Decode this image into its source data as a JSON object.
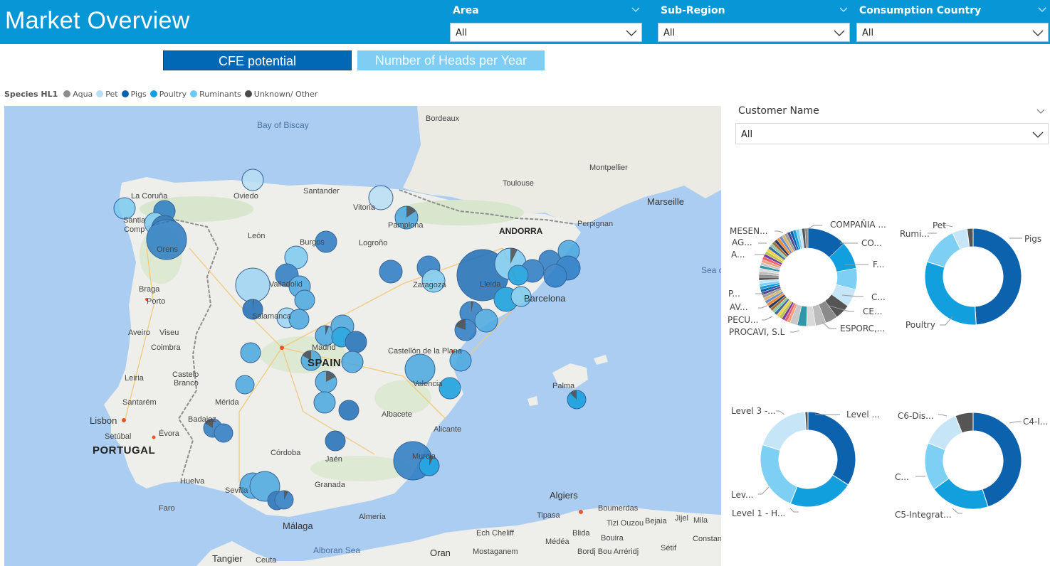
{
  "header": {
    "title": "Market Overview",
    "slicers": [
      {
        "label": "Area",
        "value": "All"
      },
      {
        "label": "Sub-Region",
        "value": "All"
      },
      {
        "label": "Consumption Country",
        "value": "All"
      }
    ]
  },
  "toggles": {
    "active": "CFE potential",
    "inactive": "Number of Heads per Year"
  },
  "legend": {
    "title": "Species HL1",
    "items": [
      {
        "label": "Aqua",
        "color": "#8c8c8c"
      },
      {
        "label": "Pet",
        "color": "#b8def5"
      },
      {
        "label": "Pigs",
        "color": "#0d62ad"
      },
      {
        "label": "Poultry",
        "color": "#129fde"
      },
      {
        "label": "Ruminants",
        "color": "#6dc9f0"
      },
      {
        "label": "Unknown/ Other",
        "color": "#4a4a4a"
      }
    ]
  },
  "map": {
    "labels": {
      "bay": "Bay of Biscay",
      "bordeaux": "Bordeaux",
      "montpellier": "Montpellier",
      "toulouse": "Toulouse",
      "marseille": "Marseille",
      "perpignan": "Perpignan",
      "andorra": "ANDORRA",
      "sea": "Sea o",
      "lacoruna": "La Coruña",
      "santiago": "Santia",
      "compostela": "Comp",
      "ourense": "Orens",
      "oviedo": "Oviedo",
      "santander": "Santander",
      "vitoria": "Vitoria",
      "pamplona": "Pamplona",
      "leon": "León",
      "burgos": "Burgos",
      "logrono": "Logroño",
      "braga": "Braga",
      "porto": "Porto",
      "valladolid": "Valladolid",
      "zaragoza": "Zaragoza",
      "lleida": "Lleida",
      "barcelona": "Barcelona",
      "salamanca": "Salamanca",
      "aveiro": "Aveiro",
      "viseu": "Viseu",
      "coimbra": "Coimbra",
      "madrid": "Madrid",
      "spain": "SPAIN",
      "castellon": "Castellón de la Plana",
      "leiria": "Leiria",
      "castelo": "Castelo",
      "branco": "Branco",
      "palma": "Palma",
      "valencia": "Valencia",
      "santarem": "Santarém",
      "merida": "Mérida",
      "albacete": "Albacete",
      "lisbon": "Lisbon",
      "setubal": "Setúbal",
      "badajoz": "Badajoz",
      "evora": "Évora",
      "portugal": "PORTUGAL",
      "alicante": "Alicante",
      "cordoba": "Córdoba",
      "jaen": "Jaén",
      "murcia": "Murcia",
      "huelva": "Huelva",
      "sevilla": "Sevilla",
      "granada": "Granada",
      "faro": "Faro",
      "malaga": "Málaga",
      "almeria": "Almería",
      "algiers": "Algiers",
      "tipasa": "Tipasa",
      "boumerdas": "Boumerdas",
      "tiziouzou": "Tizi Ouzou",
      "bejaia": "Bejaia",
      "jijel": "Jijel",
      "mila": "Mila",
      "echcheliff": "Ech Cheliff",
      "blida": "Blida",
      "medea": "Médéa",
      "bouira": "Bouira",
      "alboran": "Alboran Sea",
      "oran": "Oran",
      "mostaganem": "Mostaganem",
      "bordj": "Bordj Bou Arréridj",
      "setif": "Sétif",
      "constan": "Constan",
      "tangier": "Tangier",
      "ceuta": "Ceuta"
    }
  },
  "customer": {
    "label": "Customer Name",
    "value": "All"
  },
  "donuts": {
    "customers": {
      "labels": [
        "COMPAÑIA ...",
        "CO...",
        "F...",
        "C...",
        "CE...",
        "ESPORC,...",
        "PROCAVI, S.L",
        "PECU...",
        "AV...",
        "P...",
        "A...",
        "AG...",
        "MESEN..."
      ]
    },
    "species": {
      "labels": [
        "Pigs",
        "Poultry",
        "Rumi...",
        "Pet"
      ],
      "slices": [
        {
          "label": "Pigs",
          "value": 0.49,
          "color": "#0d62ad"
        },
        {
          "label": "Poultry",
          "value": 0.31,
          "color": "#129fde"
        },
        {
          "label": "Rumi...",
          "value": 0.13,
          "color": "#7dd0f4"
        },
        {
          "label": "Pet",
          "value": 0.05,
          "color": "#c6e6f8"
        },
        {
          "label": "Unknown/ Other",
          "value": 0.02,
          "color": "#555555"
        }
      ]
    },
    "levels": {
      "labels": [
        "Level ...",
        "Level 3 -...",
        "Lev...",
        "Level 1 - H..."
      ],
      "slices": [
        {
          "label": "Level ...",
          "value": 0.34,
          "color": "#0d62ad"
        },
        {
          "label": "Level 1 - H...",
          "value": 0.22,
          "color": "#129fde"
        },
        {
          "label": "Lev...",
          "value": 0.24,
          "color": "#7dd0f4"
        },
        {
          "label": "Level 3 -...",
          "value": 0.19,
          "color": "#c6e6f8"
        },
        {
          "label": "",
          "value": 0.01,
          "color": "#555555"
        }
      ]
    },
    "channels": {
      "labels": [
        "C4-I...",
        "C6-Dis...",
        "C...",
        "C5-Integrat..."
      ],
      "slices": [
        {
          "label": "C4-I...",
          "value": 0.45,
          "color": "#0d62ad"
        },
        {
          "label": "C5-Integrat...",
          "value": 0.2,
          "color": "#129fde"
        },
        {
          "label": "C...",
          "value": 0.16,
          "color": "#7dd0f4"
        },
        {
          "label": "C6-Dis...",
          "value": 0.13,
          "color": "#c6e6f8"
        },
        {
          "label": "",
          "value": 0.06,
          "color": "#555555"
        }
      ]
    }
  }
}
